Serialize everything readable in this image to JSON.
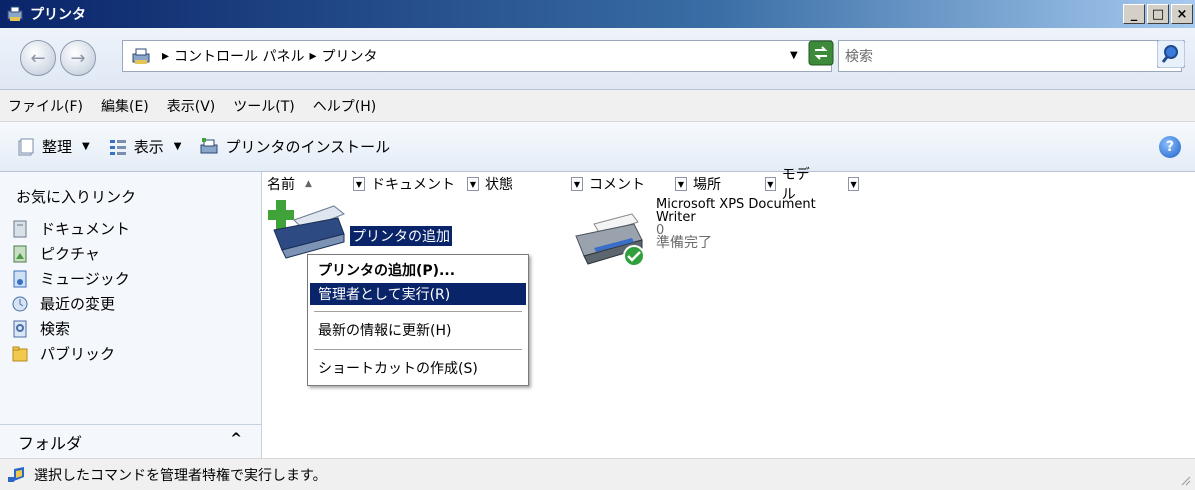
{
  "window": {
    "title": "プリンタ",
    "minimize_label": "_",
    "maximize_label": "□",
    "close_label": "×"
  },
  "address": {
    "separator": "▸",
    "crumbs": [
      "コントロール パネル",
      "プリンタ"
    ],
    "search_placeholder": "検索"
  },
  "menu": {
    "items": [
      "ファイル(F)",
      "編集(E)",
      "表示(V)",
      "ツール(T)",
      "ヘルプ(H)"
    ]
  },
  "toolbar": {
    "organize": "整理",
    "view": "表示",
    "install": "プリンタのインストール"
  },
  "sidebar": {
    "favorites_title": "お気に入りリンク",
    "items": [
      "ドキュメント",
      "ピクチャ",
      "ミュージック",
      "最近の変更",
      "検索",
      "パブリック"
    ],
    "folders_label": "フォルダ"
  },
  "columns": [
    "名前",
    "ドキュメント",
    "状態",
    "コメント",
    "場所",
    "モデル"
  ],
  "content": {
    "add_printer_label": "プリンタの追加",
    "printer_name_line1": "Microsoft XPS Document",
    "printer_name_line2": "Writer",
    "printer_docs": "0",
    "printer_status": "準備完了"
  },
  "context_menu": {
    "items": [
      "プリンタの追加(P)...",
      "管理者として実行(R)",
      "最新の情報に更新(H)",
      "ショートカットの作成(S)"
    ]
  },
  "status": {
    "text": "選択したコマンドを管理者特権で実行します。"
  }
}
